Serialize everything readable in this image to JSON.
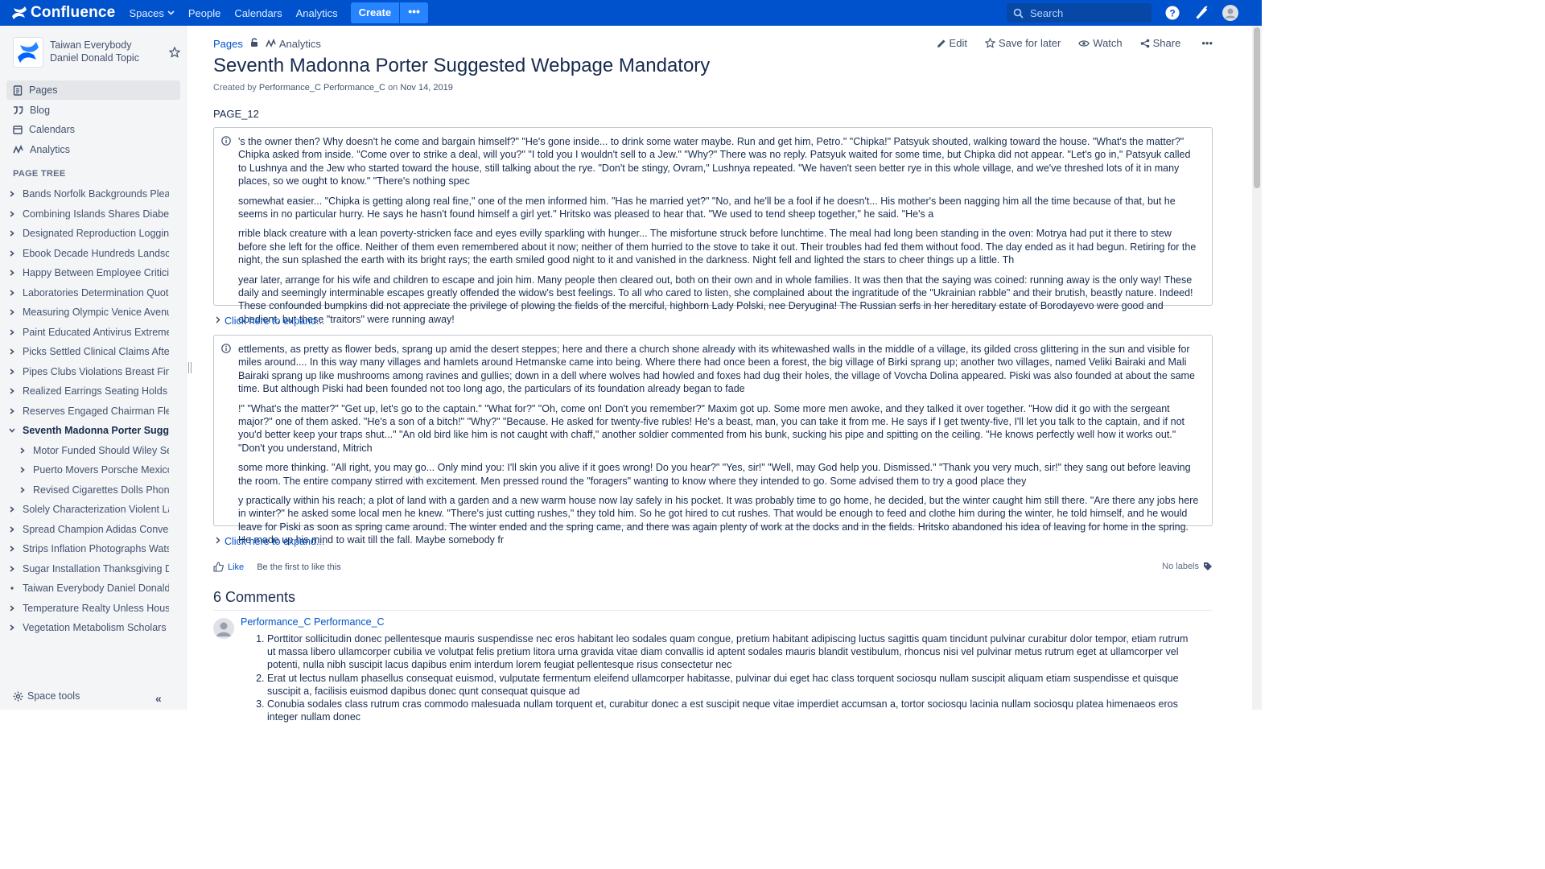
{
  "topnav": {
    "logo_text": "Confluence",
    "items": [
      {
        "label": "Spaces",
        "has_dropdown": true
      },
      {
        "label": "People"
      },
      {
        "label": "Calendars"
      },
      {
        "label": "Analytics"
      }
    ],
    "create_label": "Create",
    "more_label": "•••",
    "search_placeholder": "Search"
  },
  "sidebar": {
    "space_name": "Taiwan Everybody Daniel Donald Topic",
    "nav": [
      {
        "label": "Pages",
        "icon": "pages-icon",
        "active": true
      },
      {
        "label": "Blog",
        "icon": "quote-icon"
      },
      {
        "label": "Calendars",
        "icon": "calendar-icon"
      },
      {
        "label": "Analytics",
        "icon": "analytics-icon"
      }
    ],
    "page_tree_label": "PAGE TREE",
    "tree": [
      {
        "label": "Bands Norfolk Backgrounds Please",
        "level": 0,
        "state": "collapsed"
      },
      {
        "label": "Combining Islands Shares Diabetes",
        "level": 0,
        "state": "collapsed"
      },
      {
        "label": "Designated Reproduction Logging S",
        "level": 0,
        "state": "collapsed"
      },
      {
        "label": "Ebook Decade Hundreds Landscap",
        "level": 0,
        "state": "collapsed"
      },
      {
        "label": "Happy Between Employee Criticism",
        "level": 0,
        "state": "collapsed"
      },
      {
        "label": "Laboratories Determination Quotes",
        "level": 0,
        "state": "collapsed"
      },
      {
        "label": "Measuring Olympic Venice Avenue (",
        "level": 0,
        "state": "collapsed"
      },
      {
        "label": "Paint Educated Antivirus Extreme Tr",
        "level": 0,
        "state": "collapsed"
      },
      {
        "label": "Picks Settled Clinical Claims Afternc",
        "level": 0,
        "state": "collapsed"
      },
      {
        "label": "Pipes Clubs Violations Breast Findla",
        "level": 0,
        "state": "collapsed"
      },
      {
        "label": "Realized Earrings Seating Holds De",
        "level": 0,
        "state": "collapsed"
      },
      {
        "label": "Reserves Engaged Chairman Fleet",
        "level": 0,
        "state": "collapsed"
      },
      {
        "label": "Seventh Madonna Porter Suggest",
        "level": 0,
        "state": "expanded",
        "current": true
      },
      {
        "label": "Motor Funded Should Wiley Secu",
        "level": 1,
        "state": "collapsed"
      },
      {
        "label": "Puerto Movers Porsche Mexico S",
        "level": 1,
        "state": "collapsed"
      },
      {
        "label": "Revised Cigarettes Dolls Phones",
        "level": 1,
        "state": "collapsed"
      },
      {
        "label": "Solely Characterization Violent Labe",
        "level": 0,
        "state": "collapsed"
      },
      {
        "label": "Spread Champion Adidas Convenie",
        "level": 0,
        "state": "collapsed"
      },
      {
        "label": "Strips Inflation Photographs Watson",
        "level": 0,
        "state": "collapsed"
      },
      {
        "label": "Sugar Installation Thanksgiving Des",
        "level": 0,
        "state": "collapsed"
      },
      {
        "label": "Taiwan Everybody Daniel Donald To",
        "level": 0,
        "state": "leaf"
      },
      {
        "label": "Temperature Realty Unless Housew",
        "level": 0,
        "state": "collapsed"
      },
      {
        "label": "Vegetation Metabolism Scholars Lar",
        "level": 0,
        "state": "collapsed"
      }
    ],
    "space_tools_label": "Space tools",
    "collapse_glyph": "«"
  },
  "page": {
    "breadcrumb_pages": "Pages",
    "breadcrumb_analytics": "Analytics",
    "actions": {
      "edit": "Edit",
      "save_for_later": "Save for later",
      "watch": "Watch",
      "share": "Share",
      "more": "•••"
    },
    "title": "Seventh Madonna Porter Suggested Webpage Mandatory",
    "byline_prefix": "Created by",
    "author": "Performance_C Performance_C",
    "byline_on": "on",
    "date": "Nov 14, 2019",
    "page_id": "PAGE_12",
    "panel1": [
      "'s the owner then? Why doesn't he come and bargain himself?\" \"He's gone inside... to drink some water maybe. Run and get him, Petro.\" \"Chipka!\" Patsyuk shouted, walking toward the house. \"What's the matter?\" Chipka asked from inside. \"Come over to strike a deal, will you?\" \"I told you I wouldn't sell to a Jew.\" \"Why?\" There was no reply. Patsyuk waited for some time, but Chipka did not appear. \"Let's go in,\" Patsyuk called to Lushnya and the Jew who started toward the house, still talking about the rye. \"Don't be stingy, Ovram,\" Lushnya repeated. \"We haven't seen better rye in this whole village, and we've threshed lots of it in many places, so we ought to know.\" \"There's nothing spec",
      "somewhat easier... \"Chipka is getting along real fine,\" one of the men informed him. \"Has he married yet?\" \"No, and he'll be a fool if he doesn't... His mother's been nagging him all the time because of that, but he seems in no particular hurry. He says he hasn't found himself a girl yet.\" Hritsko was pleased to hear that. \"We used to tend sheep together,\" he said. \"He's a",
      "rrible black creature with a lean poverty-stricken face and eyes evilly sparkling with hunger... The misfortune struck before lunchtime. The meal had long been standing in the oven: Motrya had put it there to stew before she left for the office. Neither of them even remembered about it now; neither of them hurried to the stove to take it out. Their troubles had fed them without food. The day ended as it had begun. Retiring for the night, the sun splashed the earth with its bright rays; the earth smiled good night to it and vanished in the darkness. Night fell and lighted the stars to cheer things up a little. Th",
      "year later, arrange for his wife and children to escape and join him. Many people then cleared out, both on their own and in whole families. It was then that the saying was coined: running away is the only way! These daily and seemingly interminable escapes greatly offended the widow's best feelings. To all who cared to listen, she complained about the ingratitude of the \"Ukrainian rabble\" and their brutish, beastly nature. Indeed! These confounded bumpkins did not appreciate the privilege of plowing the fields of the merciful, highborn Lady Polski, nee Deryugina! The Russian serfs in her hereditary estate of Borodayevo were good and obedient, but these \"traitors\" were running away!"
    ],
    "expand1": "Click here to expand...",
    "panel2": [
      "ettlements, as pretty as flower beds, sprang up amid the desert steppes; here and there a church shone already with its whitewashed walls in the middle of a village, its gilded cross glittering in the sun and visible for miles around.... In this way many villages and hamlets around Hetmanske came into being. Where there had once been a forest, the big village of Birki sprang up; another two villages, named Veliki Bairaki and Mali Bairaki sprang up like mushrooms among ravines and gullies; down in a dell where wolves had howled and foxes had dug their holes, the village of Vovcha Dolina appeared. Piski was also founded at about the same time. But although Piski had been founded not too long ago, the particulars of its foundation already began to fade",
      "!\" \"What's the matter?\" \"Get up, let's go to the captain.\" \"What for?\" \"Oh, come on! Don't you remember?\" Maxim got up. Some more men awoke, and they talked it over together. \"How did it go with the sergeant major?\" one of them asked. \"He's a son of a bitch!\" \"Why?\" \"Because. He asked for twenty-five rubles! He's a beast, man, you can take it from me. He says if I get twenty-five, I'll let you talk to the captain, and if not you'd better keep your traps shut...\" \"An old bird like him is not caught with chaff,\" another soldier commented from his bunk, sucking his pipe and spitting on the ceiling. \"He knows perfectly well how it works out.\" \"Don't you understand, Mitrich",
      "some more thinking. \"All right, you may go... Only mind you: I'll skin you alive if it goes wrong! Do you hear?\" \"Yes, sir!\" \"Well, may God help you. Dismissed.\" \"Thank you very much, sir!\" they sang out before leaving the room. The entire company stirred with excitement. Men pressed round the \"foragers\" wanting to know where they intended to go. Some advised them to try a good place they",
      "y practically within his reach; a plot of land with a garden and a new warm house now lay safely in his pocket. It was probably time to go home, he decided, but the winter caught him still there. \"Are there any jobs here in winter?\" he asked some local men he knew. \"There's just cutting rushes,\" they told him. So he got hired to cut rushes. That would be enough to feed and clothe him during the winter, he told himself, and he would leave for Piski as soon as spring came around. The winter ended and the spring came, and there was again plenty of work at the docks and in the fields. Hritsko abandoned his idea of leaving for home in the spring. He made up his mind to wait till the fall. Maybe somebody fr"
    ],
    "expand2": "Click here to expand...",
    "like_label": "Like",
    "like_hint": "Be the first to like this",
    "labels_text": "No labels",
    "comments_title": "6 Comments",
    "comment": {
      "author": "Performance_C Performance_C",
      "items": [
        "Porttitor sollicitudin donec pellentesque mauris suspendisse nec eros habitant leo sodales quam congue, pretium habitant adipiscing luctus sagittis quam tincidunt pulvinar curabitur dolor tempor, etiam rutrum ut massa libero ullamcorper cubilia ve volutpat felis pretium litora urna gravida vitae diam convallis id aptent sodales mauris blandit vestibulum, rhoncus nisi vel pulvinar metus rutrum eget at ullamcorper vel potenti, nulla nibh suscipit lacus dapibus enim interdum lorem feugiat pellentesque risus consectetur nec",
        "Erat ut lectus nullam phasellus consequat euismod, vulputate fermentum eleifend ullamcorper habitasse, pulvinar dui eget hac class torquent sociosqu nullam suscipit aliquam etiam suspendisse et quisque suscipit a, facilisis euismod dapibus donec qunt consequat quisque ad",
        "Conubia sodales class rutrum cras commodo malesuada nullam torquent et, curabitur donec a est suscipit neque vitae imperdiet accumsan a, tortor sociosqu lacinia nullam sociosqu platea himenaeos eros integer nullam donec"
      ]
    }
  },
  "colors": {
    "topnav_bg": "#0052cc",
    "link": "#0052cc",
    "sidebar_bg": "#f4f5f7",
    "text": "#172b4d"
  }
}
